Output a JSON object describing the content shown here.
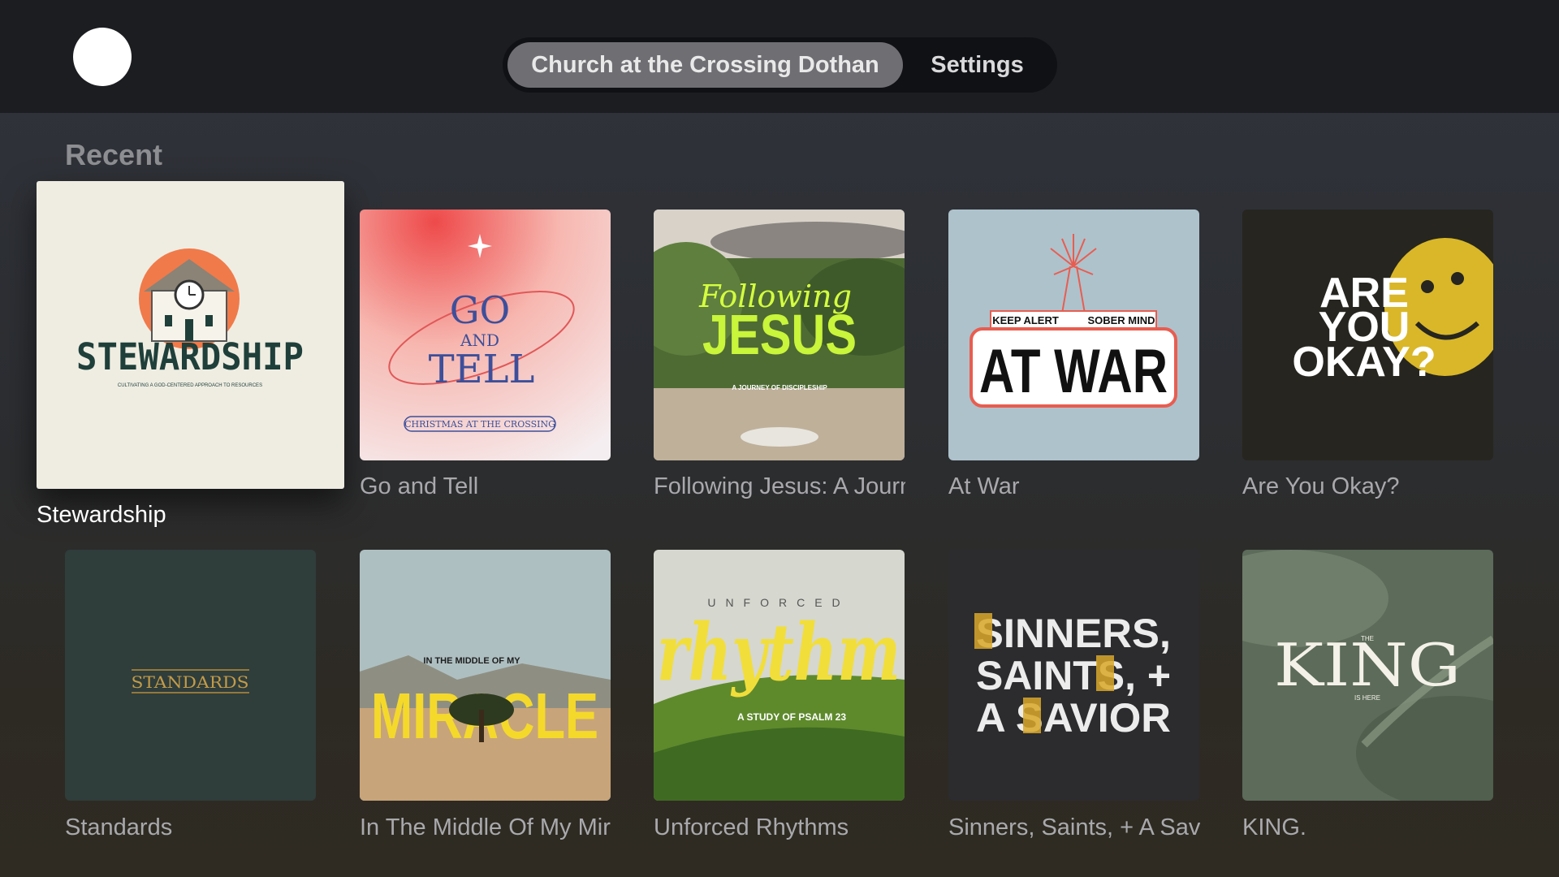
{
  "nav": {
    "tabs": [
      {
        "label": "Church at the Crossing Dothan",
        "selected": true
      },
      {
        "label": "Settings",
        "selected": false
      }
    ]
  },
  "section": {
    "title": "Recent"
  },
  "items": [
    {
      "title": "Stewardship",
      "art_title": "STEWARDSHIP",
      "art_subtitle": "CULTIVATING A GOD-CENTERED APPROACH TO RESOURCES",
      "focused": true
    },
    {
      "title": "Go and Tell",
      "art_line1": "GO",
      "art_line2": "AND",
      "art_line3": "TELL",
      "art_badge": "CHRISTMAS AT THE CROSSING"
    },
    {
      "title": "Following Jesus: A Journey of Discipleship",
      "art_script": "Following",
      "art_title": "JESUS",
      "art_subtitle": "A JOURNEY OF DISCIPLESHIP"
    },
    {
      "title": "At War",
      "art_left": "KEEP ALERT",
      "art_right": "SOBER MIND",
      "art_title": "AT WAR"
    },
    {
      "title": "Are You Okay?",
      "art_line1": "ARE",
      "art_line2": "YOU",
      "art_line3": "OKAY?"
    },
    {
      "title": "Standards",
      "art_title": "STANDARDS"
    },
    {
      "title": "In The Middle Of My Miracle",
      "art_small": "IN THE MIDDLE OF MY",
      "art_title": "MIRACLE"
    },
    {
      "title": "Unforced Rhythms",
      "art_small": "UNFORCED",
      "art_title": "rhythm",
      "art_subtitle": "A STUDY OF PSALM 23"
    },
    {
      "title": "Sinners, Saints, + A Savior",
      "art_line1": "SINNERS,",
      "art_line2": "SAINTS, +",
      "art_line3": "A SAVIOR"
    },
    {
      "title": "KING.",
      "art_small": "THE",
      "art_title": "KING",
      "art_subtitle": "IS HERE"
    }
  ],
  "colors": {
    "topbar": "#1c1d21",
    "nav_selected": "#6f6f73",
    "caption": "#a9a9ad",
    "section_title": "#8d8e92"
  }
}
